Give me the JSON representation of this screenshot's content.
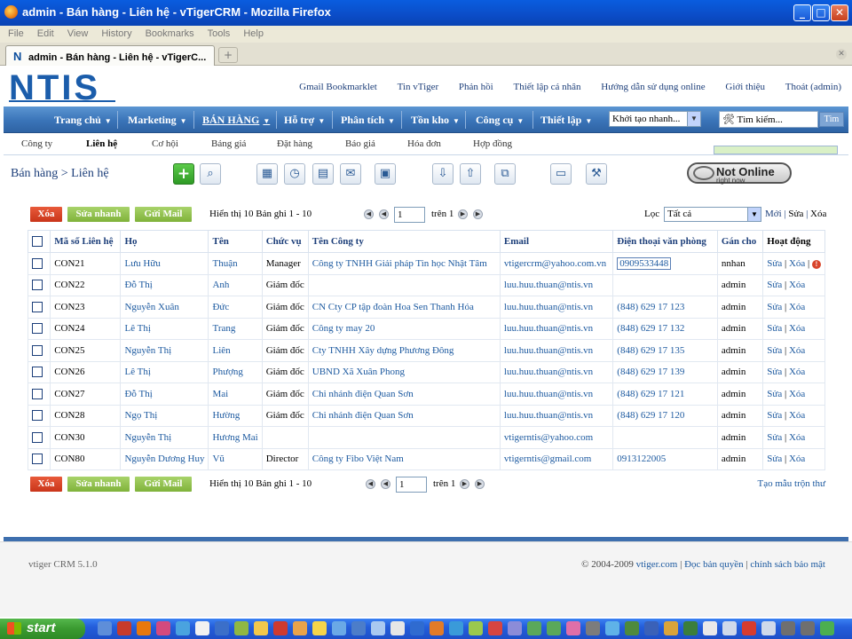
{
  "window": {
    "title": "admin - Bán hàng - Liên hệ - vTigerCRM - Mozilla Firefox",
    "menu": [
      "File",
      "Edit",
      "View",
      "History",
      "Bookmarks",
      "Tools",
      "Help"
    ],
    "tab_title": "admin - Bán hàng - Liên hệ - vTigerC...",
    "new_tab": "+",
    "minimize": "_",
    "maximize": "□",
    "close": "✕"
  },
  "header": {
    "logo": "NTIS",
    "links": [
      "Gmail Bookmarklet",
      "Tin vTiger",
      "Phản hồi",
      "Thiết lập cá nhân",
      "Hướng dẫn sử dụng online",
      "Giới thiệu",
      "Thoát (admin)"
    ]
  },
  "nav": {
    "items": [
      {
        "label": "Trang chủ",
        "active": false
      },
      {
        "label": "Marketing",
        "active": false
      },
      {
        "label": "BÁN HÀNG",
        "active": true
      },
      {
        "label": "Hỗ trợ",
        "active": false
      },
      {
        "label": "Phân tích",
        "active": false
      },
      {
        "label": "Tồn kho",
        "active": false
      },
      {
        "label": "Công cụ",
        "active": false
      },
      {
        "label": "Thiết lập",
        "active": false
      }
    ],
    "quick_create": "Khởi tạo nhanh...",
    "search_placeholder": "Tìm kiếm...",
    "search_button": "Tìm"
  },
  "subnav": {
    "items": [
      "Công ty",
      "Liên hệ",
      "Cơ hội",
      "Bảng giá",
      "Đặt hàng",
      "Báo giá",
      "Hóa đơn",
      "Hợp đồng"
    ],
    "active": "Liên hệ"
  },
  "breadcrumb": "Bán hàng > Liên hệ",
  "toolbar_icons": [
    "add-icon",
    "search-icon",
    "calendar-icon",
    "clock-icon",
    "calculator-icon",
    "chat-icon",
    "clipboard-icon",
    "import-icon",
    "export-icon",
    "find-duplicates-icon",
    "monitor-icon",
    "settings-icon"
  ],
  "status": {
    "big": "Not Online",
    "small": "right now"
  },
  "list": {
    "delete_button": "Xóa",
    "mass_edit_button": "Sửa nhanh",
    "send_mail_button": "Gửi Mail",
    "record_info": "Hiển thị 10 Bản ghi 1 - 10",
    "page_value": "1",
    "page_of": "trên 1",
    "filter_label": "Lọc",
    "filter_value": "Tất cả",
    "filter_new": "Mới",
    "filter_edit": "Sửa",
    "filter_delete": "Xóa",
    "mail_merge": "Tạo mẫu trộn thư",
    "columns": [
      "Mã số Liên hệ",
      "Họ",
      "Tên",
      "Chức vụ",
      "Tên Công ty",
      "Email",
      "Điện thoại văn phòng",
      "Gán cho",
      "Hoạt động"
    ],
    "rows": [
      {
        "id": "CON21",
        "last": "Lưu Hữu",
        "first": "Thuận",
        "title": "Manager",
        "company": "Công ty TNHH Giải pháp Tin học Nhật Tâm",
        "email": "vtigercrm@yahoo.com.vn",
        "phone": "0909533448",
        "owner": "nnhan",
        "edit": "Sửa",
        "del": "Xóa"
      },
      {
        "id": "CON22",
        "last": "Đỗ Thị",
        "first": "Anh",
        "title": "Giám đốc",
        "company": "",
        "email": "luu.huu.thuan@ntis.vn",
        "phone": "",
        "owner": "admin",
        "edit": "Sửa",
        "del": "Xóa"
      },
      {
        "id": "CON23",
        "last": "Nguyễn Xuân",
        "first": "Đức",
        "title": "Giám đốc",
        "company": "CN Cty CP tập đoàn Hoa Sen Thanh Hóa",
        "email": "luu.huu.thuan@ntis.vn",
        "phone": "(848) 629 17 123",
        "owner": "admin",
        "edit": "Sửa",
        "del": "Xóa"
      },
      {
        "id": "CON24",
        "last": "Lê Thị",
        "first": "Trang",
        "title": "Giám đốc",
        "company": "Công ty may 20",
        "email": "luu.huu.thuan@ntis.vn",
        "phone": "(848) 629 17 132",
        "owner": "admin",
        "edit": "Sửa",
        "del": "Xóa"
      },
      {
        "id": "CON25",
        "last": "Nguyễn Thị",
        "first": "Liên",
        "title": "Giám đốc",
        "company": "Cty TNHH Xây dựng Phương Đông",
        "email": "luu.huu.thuan@ntis.vn",
        "phone": "(848) 629 17 135",
        "owner": "admin",
        "edit": "Sửa",
        "del": "Xóa"
      },
      {
        "id": "CON26",
        "last": "Lê Thị",
        "first": "Phượng",
        "title": "Giám đốc",
        "company": "UBND Xã Xuân Phong",
        "email": "luu.huu.thuan@ntis.vn",
        "phone": "(848) 629 17 139",
        "owner": "admin",
        "edit": "Sửa",
        "del": "Xóa"
      },
      {
        "id": "CON27",
        "last": "Đỗ Thị",
        "first": "Mai",
        "title": "Giám đốc",
        "company": "Chi nhánh điện Quan Sơn",
        "email": "luu.huu.thuan@ntis.vn",
        "phone": "(848) 629 17 121",
        "owner": "admin",
        "edit": "Sửa",
        "del": "Xóa"
      },
      {
        "id": "CON28",
        "last": "Ngọ Thị",
        "first": "Hường",
        "title": "Giám đốc",
        "company": "Chi nhánh điện Quan Sơn",
        "email": "luu.huu.thuan@ntis.vn",
        "phone": "(848) 629 17 120",
        "owner": "admin",
        "edit": "Sửa",
        "del": "Xóa"
      },
      {
        "id": "CON30",
        "last": "Nguyễn Thị",
        "first": "Hương Mai",
        "title": "",
        "company": "",
        "email": "vtigerntis@yahoo.com",
        "phone": "",
        "owner": "admin",
        "edit": "Sửa",
        "del": "Xóa"
      },
      {
        "id": "CON80",
        "last": "Nguyễn Dương Huy",
        "first": "Vũ",
        "title": "Director",
        "company": "Công ty Fibo Việt Nam",
        "email": "vtigerntis@gmail.com",
        "phone": "0913122005",
        "owner": "admin",
        "edit": "Sửa",
        "del": "Xóa"
      }
    ]
  },
  "footer": {
    "version": "vtiger CRM 5.1.0",
    "copyright": "© 2004-2009",
    "vtiger_link": "vtiger.com",
    "license": "Đọc bản quyền",
    "privacy": "chính sách bảo mật"
  },
  "taskbar": {
    "start": "start"
  }
}
